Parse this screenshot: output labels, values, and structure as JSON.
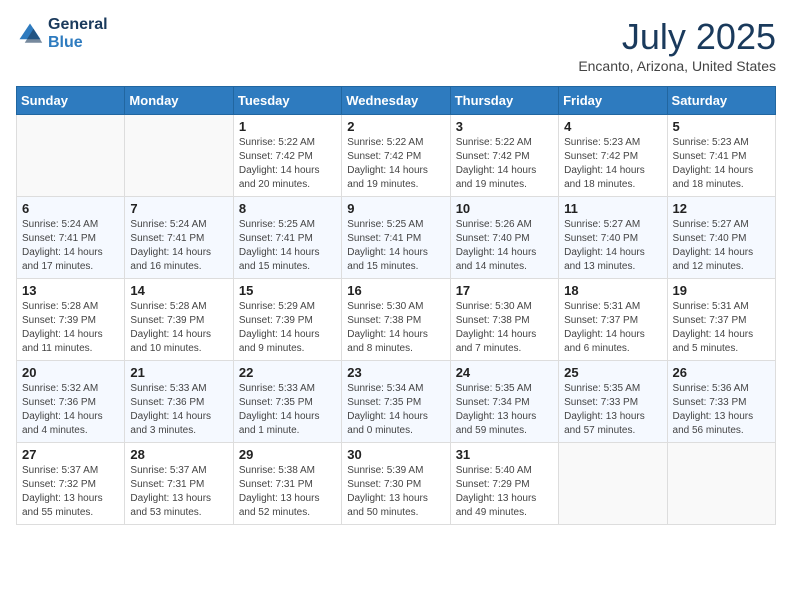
{
  "header": {
    "logo_line1": "General",
    "logo_line2": "Blue",
    "month": "July 2025",
    "location": "Encanto, Arizona, United States"
  },
  "weekdays": [
    "Sunday",
    "Monday",
    "Tuesday",
    "Wednesday",
    "Thursday",
    "Friday",
    "Saturday"
  ],
  "weeks": [
    [
      {
        "day": "",
        "info": ""
      },
      {
        "day": "",
        "info": ""
      },
      {
        "day": "1",
        "info": "Sunrise: 5:22 AM\nSunset: 7:42 PM\nDaylight: 14 hours and 20 minutes."
      },
      {
        "day": "2",
        "info": "Sunrise: 5:22 AM\nSunset: 7:42 PM\nDaylight: 14 hours and 19 minutes."
      },
      {
        "day": "3",
        "info": "Sunrise: 5:22 AM\nSunset: 7:42 PM\nDaylight: 14 hours and 19 minutes."
      },
      {
        "day": "4",
        "info": "Sunrise: 5:23 AM\nSunset: 7:42 PM\nDaylight: 14 hours and 18 minutes."
      },
      {
        "day": "5",
        "info": "Sunrise: 5:23 AM\nSunset: 7:41 PM\nDaylight: 14 hours and 18 minutes."
      }
    ],
    [
      {
        "day": "6",
        "info": "Sunrise: 5:24 AM\nSunset: 7:41 PM\nDaylight: 14 hours and 17 minutes."
      },
      {
        "day": "7",
        "info": "Sunrise: 5:24 AM\nSunset: 7:41 PM\nDaylight: 14 hours and 16 minutes."
      },
      {
        "day": "8",
        "info": "Sunrise: 5:25 AM\nSunset: 7:41 PM\nDaylight: 14 hours and 15 minutes."
      },
      {
        "day": "9",
        "info": "Sunrise: 5:25 AM\nSunset: 7:41 PM\nDaylight: 14 hours and 15 minutes."
      },
      {
        "day": "10",
        "info": "Sunrise: 5:26 AM\nSunset: 7:40 PM\nDaylight: 14 hours and 14 minutes."
      },
      {
        "day": "11",
        "info": "Sunrise: 5:27 AM\nSunset: 7:40 PM\nDaylight: 14 hours and 13 minutes."
      },
      {
        "day": "12",
        "info": "Sunrise: 5:27 AM\nSunset: 7:40 PM\nDaylight: 14 hours and 12 minutes."
      }
    ],
    [
      {
        "day": "13",
        "info": "Sunrise: 5:28 AM\nSunset: 7:39 PM\nDaylight: 14 hours and 11 minutes."
      },
      {
        "day": "14",
        "info": "Sunrise: 5:28 AM\nSunset: 7:39 PM\nDaylight: 14 hours and 10 minutes."
      },
      {
        "day": "15",
        "info": "Sunrise: 5:29 AM\nSunset: 7:39 PM\nDaylight: 14 hours and 9 minutes."
      },
      {
        "day": "16",
        "info": "Sunrise: 5:30 AM\nSunset: 7:38 PM\nDaylight: 14 hours and 8 minutes."
      },
      {
        "day": "17",
        "info": "Sunrise: 5:30 AM\nSunset: 7:38 PM\nDaylight: 14 hours and 7 minutes."
      },
      {
        "day": "18",
        "info": "Sunrise: 5:31 AM\nSunset: 7:37 PM\nDaylight: 14 hours and 6 minutes."
      },
      {
        "day": "19",
        "info": "Sunrise: 5:31 AM\nSunset: 7:37 PM\nDaylight: 14 hours and 5 minutes."
      }
    ],
    [
      {
        "day": "20",
        "info": "Sunrise: 5:32 AM\nSunset: 7:36 PM\nDaylight: 14 hours and 4 minutes."
      },
      {
        "day": "21",
        "info": "Sunrise: 5:33 AM\nSunset: 7:36 PM\nDaylight: 14 hours and 3 minutes."
      },
      {
        "day": "22",
        "info": "Sunrise: 5:33 AM\nSunset: 7:35 PM\nDaylight: 14 hours and 1 minute."
      },
      {
        "day": "23",
        "info": "Sunrise: 5:34 AM\nSunset: 7:35 PM\nDaylight: 14 hours and 0 minutes."
      },
      {
        "day": "24",
        "info": "Sunrise: 5:35 AM\nSunset: 7:34 PM\nDaylight: 13 hours and 59 minutes."
      },
      {
        "day": "25",
        "info": "Sunrise: 5:35 AM\nSunset: 7:33 PM\nDaylight: 13 hours and 57 minutes."
      },
      {
        "day": "26",
        "info": "Sunrise: 5:36 AM\nSunset: 7:33 PM\nDaylight: 13 hours and 56 minutes."
      }
    ],
    [
      {
        "day": "27",
        "info": "Sunrise: 5:37 AM\nSunset: 7:32 PM\nDaylight: 13 hours and 55 minutes."
      },
      {
        "day": "28",
        "info": "Sunrise: 5:37 AM\nSunset: 7:31 PM\nDaylight: 13 hours and 53 minutes."
      },
      {
        "day": "29",
        "info": "Sunrise: 5:38 AM\nSunset: 7:31 PM\nDaylight: 13 hours and 52 minutes."
      },
      {
        "day": "30",
        "info": "Sunrise: 5:39 AM\nSunset: 7:30 PM\nDaylight: 13 hours and 50 minutes."
      },
      {
        "day": "31",
        "info": "Sunrise: 5:40 AM\nSunset: 7:29 PM\nDaylight: 13 hours and 49 minutes."
      },
      {
        "day": "",
        "info": ""
      },
      {
        "day": "",
        "info": ""
      }
    ]
  ]
}
